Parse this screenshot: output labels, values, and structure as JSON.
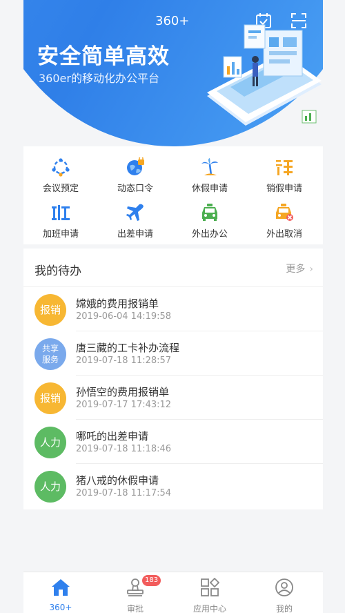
{
  "header": {
    "app_name": "360+",
    "title": "安全简单高效",
    "subtitle": "360er的移动化办公平台",
    "icons": [
      "calendar-check-icon",
      "scan-icon"
    ]
  },
  "quick_actions": [
    {
      "label": "会议预定",
      "icon": "meeting-icon",
      "color": "#2f80ed"
    },
    {
      "label": "动态口令",
      "icon": "globe-lock-icon",
      "color": "#2f80ed"
    },
    {
      "label": "休假申请",
      "icon": "palm-tree-icon",
      "color": "#2f80ed"
    },
    {
      "label": "销假申请",
      "icon": "cancel-leave-icon",
      "color": "#f5a623"
    },
    {
      "label": "加班申请",
      "icon": "overtime-icon",
      "color": "#2f80ed"
    },
    {
      "label": "出差申请",
      "icon": "airplane-icon",
      "color": "#2f80ed"
    },
    {
      "label": "外出办公",
      "icon": "taxi-icon",
      "color": "#4caf50"
    },
    {
      "label": "外出取消",
      "icon": "taxi-cancel-icon",
      "color": "#f5a623"
    }
  ],
  "todo": {
    "title": "我的待办",
    "more_label": "更多",
    "items": [
      {
        "badge": "报销",
        "badge_color": "#f7b733",
        "title": "嫦娥的费用报销单",
        "time": "2019-06-04 14:19:58"
      },
      {
        "badge": "共享服务",
        "badge_line1": "共享",
        "badge_line2": "服务",
        "badge_color": "#7aa9ec",
        "title": "唐三藏的工卡补办流程",
        "time": "2019-07-18 11:28:57"
      },
      {
        "badge": "报销",
        "badge_color": "#f7b733",
        "title": "孙悟空的费用报销单",
        "time": "2019-07-17 17:43:12"
      },
      {
        "badge": "人力",
        "badge_color": "#5dbb63",
        "title": "哪吒的出差申请",
        "time": "2019-07-18 11:18:46"
      },
      {
        "badge": "人力",
        "badge_color": "#5dbb63",
        "title": "猪八戒的休假申请",
        "time": "2019-07-18 11:17:54"
      }
    ]
  },
  "tabbar": {
    "tabs": [
      {
        "label": "360+",
        "icon": "home-icon",
        "active": true
      },
      {
        "label": "审批",
        "icon": "approval-stamp-icon",
        "badge": "183"
      },
      {
        "label": "应用中心",
        "icon": "app-center-icon"
      },
      {
        "label": "我的",
        "icon": "profile-icon"
      }
    ]
  },
  "colors": {
    "primary": "#2f80ed",
    "accent_orange": "#f5a623",
    "green": "#4caf50",
    "badge_red": "#f25c5c"
  }
}
